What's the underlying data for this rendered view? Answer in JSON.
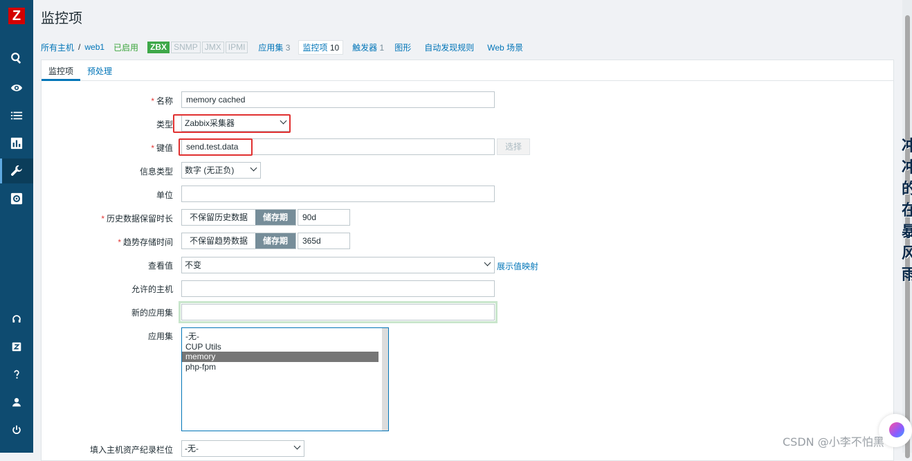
{
  "app": {
    "logo_letter": "Z",
    "page_title": "监控项"
  },
  "sidebar": {
    "items": [
      {
        "name": "search-icon"
      },
      {
        "name": "eye-icon"
      },
      {
        "name": "list-icon"
      },
      {
        "name": "chart-icon"
      },
      {
        "name": "wrench-icon",
        "active": true
      },
      {
        "name": "gear-icon"
      }
    ],
    "bottom": [
      {
        "name": "headset-icon"
      },
      {
        "name": "zabbix-share-icon"
      },
      {
        "name": "help-icon"
      },
      {
        "name": "user-icon"
      },
      {
        "name": "power-icon"
      }
    ]
  },
  "topnav": {
    "all_hosts": "所有主机",
    "separator": "/",
    "host": "web1",
    "status": "已启用",
    "tags": [
      "ZBX",
      "SNMP",
      "JMX",
      "IPMI"
    ],
    "apps": {
      "label": "应用集",
      "count": "3"
    },
    "items": {
      "label": "监控项",
      "count": "10"
    },
    "triggers": {
      "label": "触发器",
      "count": "1"
    },
    "graphs": "图形",
    "discovery": "自动发现规则",
    "web": "Web 场景"
  },
  "tabs": {
    "item": "监控项",
    "preprocessing": "预处理"
  },
  "form": {
    "name": {
      "label": "名称",
      "value": "memory cached"
    },
    "type": {
      "label": "类型",
      "value": "Zabbix采集器"
    },
    "key": {
      "label": "键值",
      "value": "send.test.data",
      "select_button": "选择"
    },
    "info_type": {
      "label": "信息类型",
      "value": "数字 (无正负)"
    },
    "units": {
      "label": "单位",
      "value": ""
    },
    "history": {
      "label": "历史数据保留时长",
      "opt_off": "不保留历史数据",
      "opt_on": "储存期",
      "value": "90d"
    },
    "trends": {
      "label": "趋势存储时间",
      "opt_off": "不保留趋势数据",
      "opt_on": "储存期",
      "value": "365d"
    },
    "valuemap": {
      "label": "查看值",
      "value": "不变",
      "link": "展示值映射"
    },
    "allowed_hosts": {
      "label": "允许的主机",
      "value": ""
    },
    "new_app": {
      "label": "新的应用集",
      "value": ""
    },
    "apps": {
      "label": "应用集",
      "options": [
        "-无-",
        "CUP Utils",
        "memory",
        "php-fpm"
      ],
      "selected": "memory"
    },
    "inventory": {
      "label": "填入主机资产纪录栏位",
      "value": "-无-"
    }
  },
  "watermark": {
    "text": "CSDN @小李不怕黑",
    "vertical": "冲冲的在暴风雨"
  }
}
